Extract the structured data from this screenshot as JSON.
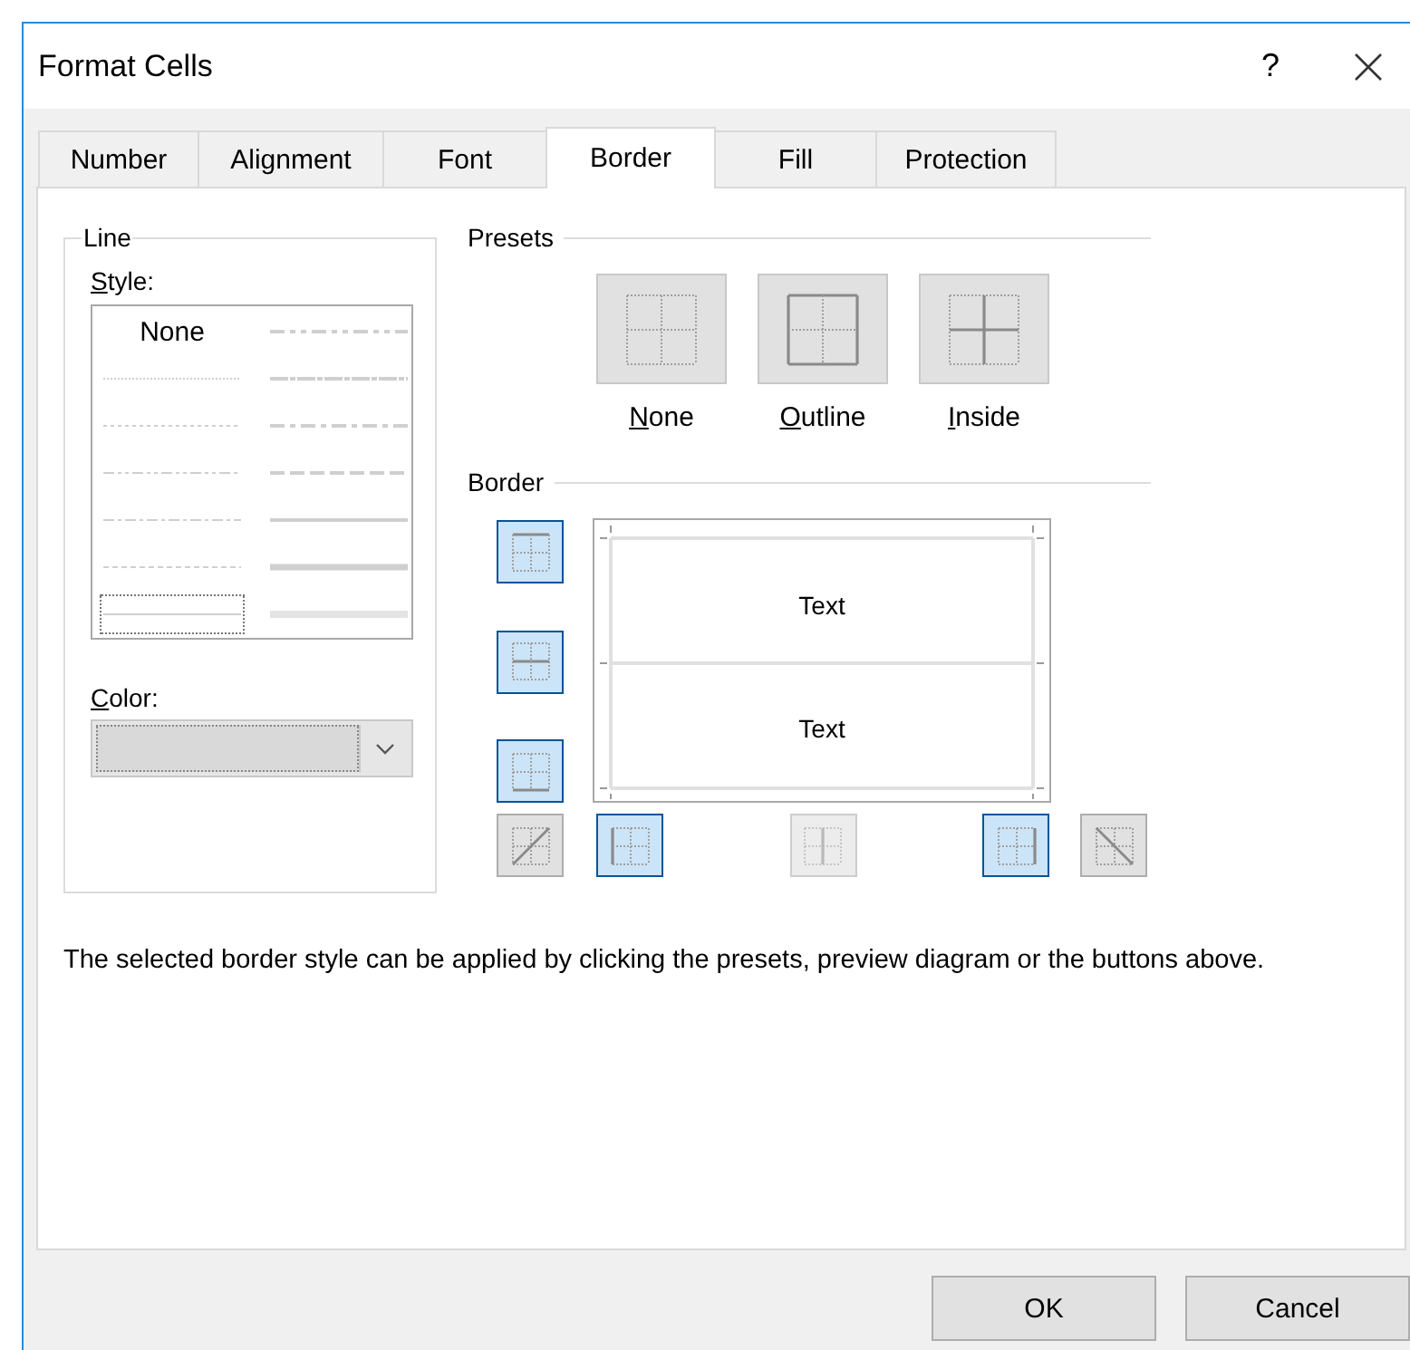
{
  "window": {
    "title": "Format Cells",
    "help": "?"
  },
  "tabs": [
    {
      "label": "Number",
      "selected": false
    },
    {
      "label": "Alignment",
      "selected": false
    },
    {
      "label": "Font",
      "selected": false
    },
    {
      "label": "Border",
      "selected": true
    },
    {
      "label": "Fill",
      "selected": false
    },
    {
      "label": "Protection",
      "selected": false
    }
  ],
  "line": {
    "heading": "Line",
    "style_label": {
      "text": "Style:",
      "underline_first": true
    },
    "styles": [
      {
        "kind": "none",
        "label": "None",
        "selected": false
      },
      {
        "kind": "hair",
        "selected": false
      },
      {
        "kind": "dotted",
        "selected": false
      },
      {
        "kind": "dash-dot-dot",
        "selected": false
      },
      {
        "kind": "dash-dot",
        "selected": false
      },
      {
        "kind": "dashed",
        "selected": false
      },
      {
        "kind": "thin",
        "selected": true
      },
      {
        "kind": "medium-dash-dot-dot",
        "selected": false
      },
      {
        "kind": "slant-dash-dot",
        "selected": false
      },
      {
        "kind": "medium-dash-dot",
        "selected": false
      },
      {
        "kind": "medium-dashed",
        "selected": false
      },
      {
        "kind": "medium",
        "selected": false
      },
      {
        "kind": "thick",
        "selected": false
      },
      {
        "kind": "double",
        "selected": false
      }
    ],
    "color_label": {
      "text": "Color:",
      "underline_first": true
    }
  },
  "presets": {
    "heading": "Presets",
    "items": [
      {
        "kind": "none",
        "label": {
          "text": "None",
          "underline_first": true
        }
      },
      {
        "kind": "outline",
        "label": {
          "text": "Outline",
          "underline_first": true
        }
      },
      {
        "kind": "inside",
        "label": {
          "text": "Inside",
          "underline_first": true
        }
      }
    ]
  },
  "border": {
    "heading": "Border",
    "preview_texts": [
      "Text",
      "Text"
    ],
    "buttons": [
      {
        "kind": "top",
        "selected": true,
        "disabled": false
      },
      {
        "kind": "middle-horizontal",
        "selected": true,
        "disabled": false
      },
      {
        "kind": "bottom",
        "selected": true,
        "disabled": false
      },
      {
        "kind": "diagonal-up",
        "selected": false,
        "disabled": false
      },
      {
        "kind": "left",
        "selected": true,
        "disabled": false
      },
      {
        "kind": "middle-vertical",
        "selected": false,
        "disabled": true
      },
      {
        "kind": "right",
        "selected": true,
        "disabled": false
      },
      {
        "kind": "diagonal-down",
        "selected": false,
        "disabled": false
      }
    ]
  },
  "note": "The selected border style can be applied by clicking the presets, preview diagram or the buttons above.",
  "buttons": [
    {
      "label": "OK"
    },
    {
      "label": "Cancel"
    }
  ]
}
